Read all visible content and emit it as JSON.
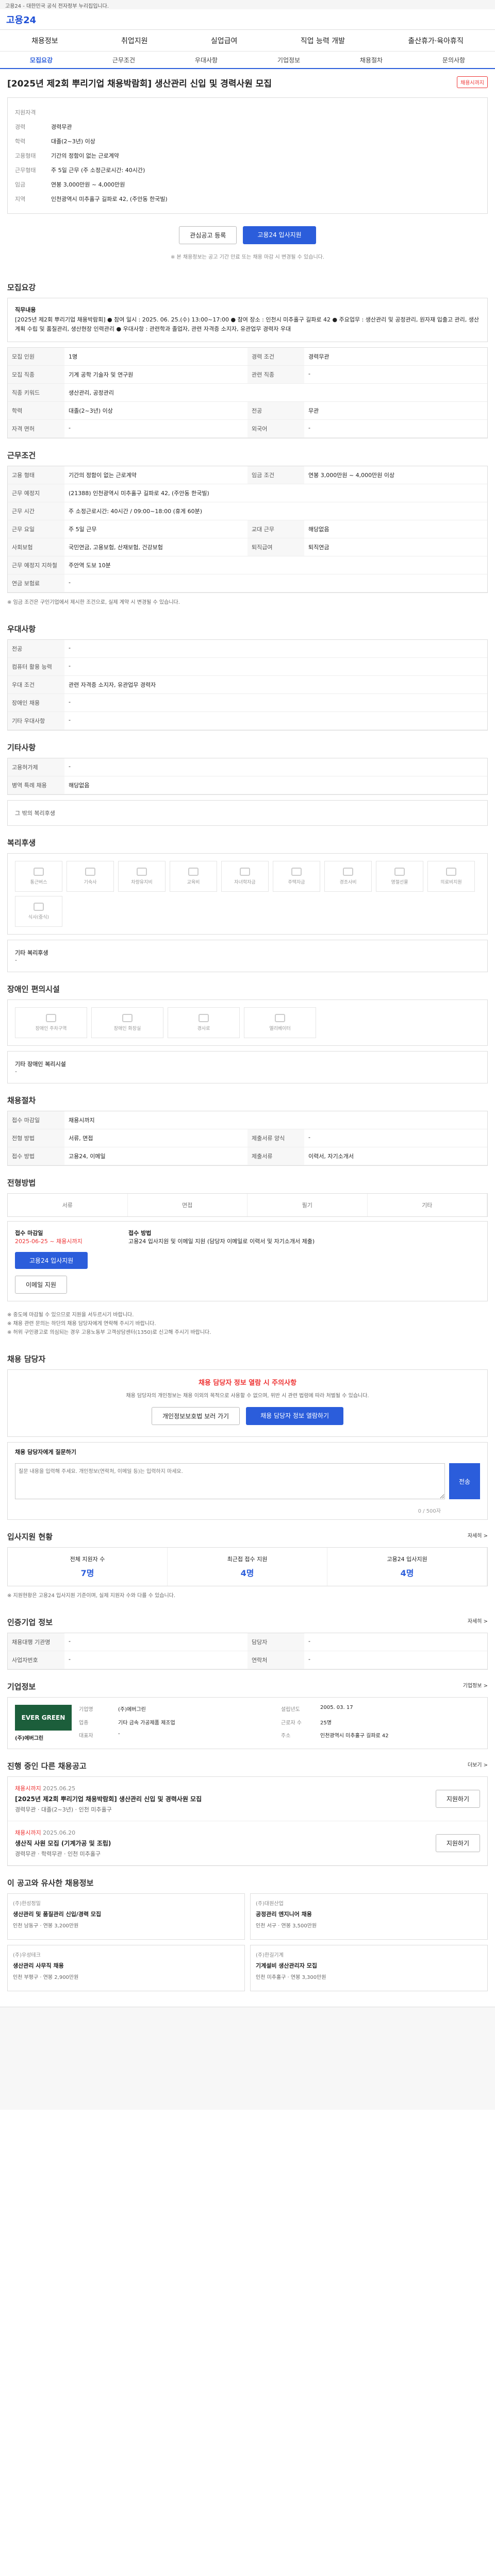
{
  "topbar": {
    "text": "고용24 - 대한민국 공식 전자정부 누리집입니다."
  },
  "header": {
    "logo": "고용24"
  },
  "nav": {
    "items": [
      "채용정보",
      "취업지원",
      "실업급여",
      "직업 능력 개발",
      "출산휴가·육아휴직"
    ]
  },
  "tabs": [
    "모집요강",
    "근무조건",
    "우대사항",
    "기업정보",
    "채용절차",
    "문의사항"
  ],
  "title": {
    "text": "[2025년 제2회 뿌리기업 채용박람회] 생산관리 신입 및 경력사원 모집",
    "badge": "채용시까지"
  },
  "summary": {
    "rows": [
      {
        "label": "지원자격",
        "value": ""
      },
      {
        "label": "경력",
        "value": "경력무관"
      },
      {
        "label": "학력",
        "value": "대졸(2~3년) 이상"
      },
      {
        "label": "고용형태",
        "value": "기간의 정함이 없는 근로계약"
      },
      {
        "label": "근무형태",
        "value": "주 5일 근무 (주 소정근로시간: 40시간)"
      },
      {
        "label": "임금",
        "value": "연봉 3,000만원 ~ 4,000만원"
      },
      {
        "label": "지역",
        "value": "인천광역시 미추홀구 길파로 42, (주안동 한국빌)"
      }
    ]
  },
  "buttons": {
    "save": "관심공고 등록",
    "apply": "고용24 입사지원"
  },
  "note": "※ 본 채용정보는 공고 기간 만료 또는 채용 마감 시 변경될 수 있습니다.",
  "sections": {
    "recruit": "모집요강",
    "cond": "근무조건",
    "pref": "우대사항",
    "svc": "기타사항",
    "welfare": "복리후생",
    "disab": "장애인 편의시설",
    "proc": "채용절차",
    "method": "전형방법",
    "qa": "채용 담당자",
    "stats": "입사지원 현황",
    "agency": "인증기업 정보",
    "company": "기업정보",
    "jobs": "진행 중인 다른 채용공고",
    "recommend": "이 공고와 유사한 채용정보"
  },
  "recruit": {
    "duty_label": "직무내용",
    "duty": "[2025년 제2회 뿌리기업 채용박람회] ● 참여 일시 : 2025. 06. 25.(수) 13:00~17:00 ● 참여 장소 : 인천시 미추홀구 길파로 42 ● 주요업무 : 생산관리 및 공정관리, 원자재 입출고 관리, 생산계획 수립 및 품질관리, 생산현장 인력관리 ● 우대사항 : 관련학과 졸업자, 관련 자격증 소지자, 유관업무 경력자 우대",
    "rows": [
      {
        "k": "모집 인원",
        "v": "1명",
        "k2": "경력 조건",
        "v2": "경력무관"
      },
      {
        "k": "모집 직종",
        "v": "기계 공학 기술자 및 연구원",
        "k2": "관련 직종",
        "v2": "-"
      },
      {
        "k": "직종 키워드",
        "v": "생산관리, 공정관리",
        "k2": "",
        "v2": ""
      },
      {
        "k": "학력",
        "v": "대졸(2~3년) 이상",
        "k2": "전공",
        "v2": "무관"
      },
      {
        "k": "자격 면허",
        "v": "-",
        "k2": "외국어",
        "v2": "-"
      }
    ]
  },
  "cond": {
    "rows": [
      {
        "k": "고용 형태",
        "v": "기간의 정함이 없는 근로계약",
        "k2": "임금 조건",
        "v2": "연봉 3,000만원 ~ 4,000만원 이상"
      },
      {
        "k": "근무 예정지",
        "v": "(21388) 인천광역시 미추홀구 길파로 42, (주안동 한국빌)"
      },
      {
        "k": "근무 시간",
        "v": "주 소정근로시간: 40시간 / 09:00~18:00 (휴게 60분)"
      },
      {
        "k": "근무 요일",
        "v": "주 5일 근무",
        "k2": "교대 근무",
        "v2": "해당없음"
      },
      {
        "k": "사회보험",
        "v": "국민연금, 고용보험, 산재보험, 건강보험",
        "k2": "퇴직급여",
        "v2": "퇴직연금"
      },
      {
        "k": "근무 예정지 지하철",
        "v": "주안역 도보 10분"
      },
      {
        "k": "연금 보험료",
        "v": "-"
      }
    ],
    "note": "※ 임금 조건은 구인기업에서 제시한 조건으로, 실제 계약 시 변경될 수 있습니다."
  },
  "pref": {
    "rows": [
      {
        "k": "전공",
        "v": "-"
      },
      {
        "k": "컴퓨터 활용 능력",
        "v": "-"
      },
      {
        "k": "우대 조건",
        "v": "관련 자격증 소지자, 유관업무 경력자"
      },
      {
        "k": "장애인 채용",
        "v": "-"
      },
      {
        "k": "기타 우대사항",
        "v": "-"
      }
    ]
  },
  "svc": {
    "rows": [
      {
        "k": "고용허가제",
        "v": "-"
      },
      {
        "k": "병역 특례 채용",
        "v": "해당없음"
      }
    ],
    "extra": "그 밖의 복리후생"
  },
  "welfare": {
    "items": [
      "통근버스",
      "기숙사",
      "차량유지비",
      "교육비",
      "자녀학자금",
      "주택자금",
      "경조사비",
      "명절선물",
      "의료비지원",
      "식사(중식)"
    ],
    "note_label": "기타 복리후생",
    "note": "-"
  },
  "disab": {
    "items": [
      "장애인 주차구역",
      "장애인 화장실",
      "경사로",
      "엘리베이터"
    ],
    "note_label": "기타 장애인 복리시설",
    "note": "-"
  },
  "proc": {
    "rows": [
      {
        "k": "접수 마감일",
        "v": "채용시까지",
        "k2": "",
        "v2": ""
      },
      {
        "k": "전형 방법",
        "v": "서류, 면접",
        "k2": "제출서류 양식",
        "v2": "-"
      },
      {
        "k": "접수 방법",
        "v": "고용24, 이메일",
        "k2": "제출서류",
        "v2": "이력서, 자기소개서"
      }
    ]
  },
  "method": {
    "items": [
      "서류",
      "면접",
      "필기",
      "기타"
    ]
  },
  "apply": {
    "left_title": "접수 마감일",
    "left_val": "2025-06-25 ~ 채용시까지",
    "btn1": "고용24 입사지원",
    "btn2": "이메일 지원",
    "right_title": "접수 방법",
    "right_val": "고용24 입사지원 및 이메일 지원 (담당자 이메일로 이력서 및 자기소개서 제출)"
  },
  "notices": [
    "※ 중도에 마감될 수 있으므로 지원을 서두르시기 바랍니다.",
    "※ 채용 관련 문의는 하단의 채용 담당자에게 연락해 주시기 바랍니다.",
    "※ 허위 구인광고로 의심되는 경우 고용노동부 고객상담센터(1350)로 신고해 주시기 바랍니다."
  ],
  "qa": {
    "alert": "채용 담당자 정보 열람 시 주의사항",
    "desc": "채용 담당자의 개인정보는 채용 이외의 목적으로 사용할 수 없으며, 위반 시 관련 법령에 따라 처벌될 수 있습니다.",
    "btn1": "개인정보보호법 보러 가기",
    "btn2": "채용 담당자 정보 열람하기",
    "ask_label": "채용 담당자에게 질문하기",
    "placeholder": "질문 내용을 입력해 주세요. 개인정보(연락처, 이메일 등)는 입력하지 마세요.",
    "count": "0 / 500자",
    "send": "전송"
  },
  "stats": {
    "more": "자세히 >",
    "items": [
      {
        "label": "전체 지원자 수",
        "value": "7명"
      },
      {
        "label": "최근접 접수 지원",
        "value": "4명"
      },
      {
        "label": "고용24 입사지원",
        "value": "4명"
      }
    ],
    "note": "※ 지원현황은 고용24 입사지원 기준이며, 실제 지원자 수와 다를 수 있습니다."
  },
  "agency": {
    "more": "자세히 >",
    "rows": [
      {
        "k": "채용대행 기관명",
        "v": "-",
        "k2": "담당자",
        "v2": "-"
      },
      {
        "k": "사업자번호",
        "v": "-",
        "k2": "연락처",
        "v2": "-"
      }
    ]
  },
  "company": {
    "name": "(주)에버그린",
    "logo": "EVER GREEN",
    "more": "기업정보 >",
    "info": [
      {
        "k": "기업명",
        "v": "(주)에버그린"
      },
      {
        "k": "업종",
        "v": "기타 금속 가공제품 제조업"
      },
      {
        "k": "대표자",
        "v": "-"
      },
      {
        "k": "설립년도",
        "v": "2005. 03. 17"
      },
      {
        "k": "근로자 수",
        "v": "25명"
      },
      {
        "k": "주소",
        "v": "인천광역시 미추홀구 길파로 42"
      }
    ]
  },
  "jobs": {
    "more": "더보기 >",
    "items": [
      {
        "badge": "채용시까지",
        "date": "2025.06.25",
        "title": "[2025년 제2회 뿌리기업 채용박람회] 생산관리 신입 및 경력사원 모집",
        "cond": "경력무관 · 대졸(2~3년) · 인천 미추홀구",
        "btn": "지원하기"
      },
      {
        "badge": "채용시까지",
        "date": "2025.06.20",
        "title": "생산직 사원 모집 (기계가공 및 조립)",
        "cond": "경력무관 · 학력무관 · 인천 미추홀구",
        "btn": "지원하기"
      }
    ]
  },
  "recommend": {
    "items": [
      {
        "co": "(주)한성정밀",
        "title": "생산관리 및 품질관리 신입/경력 모집",
        "cond": "인천 남동구 · 연봉 3,200만원"
      },
      {
        "co": "(주)대원산업",
        "title": "공정관리 엔지니어 채용",
        "cond": "인천 서구 · 연봉 3,500만원"
      },
      {
        "co": "(주)우성테크",
        "title": "생산관리 사무직 채용",
        "cond": "인천 부평구 · 연봉 2,900만원"
      },
      {
        "co": "(주)한길기계",
        "title": "기계설비 생산관리자 모집",
        "cond": "인천 미추홀구 · 연봉 3,300만원"
      }
    ]
  }
}
